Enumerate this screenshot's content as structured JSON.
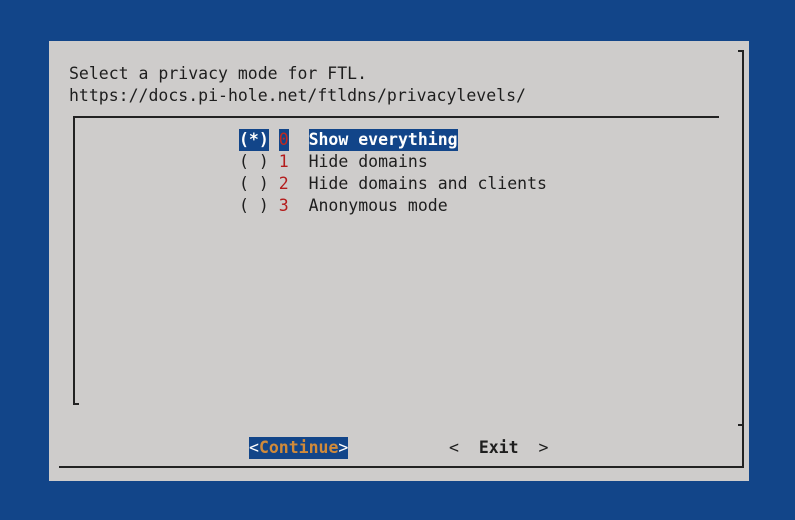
{
  "dialog": {
    "prompt_line1": "Select a privacy mode for FTL.",
    "prompt_line2": "https://docs.pi-hole.net/ftldns/privacylevels/"
  },
  "options": [
    {
      "mark": "(*)",
      "tag": "0",
      "label": "Show everything",
      "selected": true
    },
    {
      "mark": "( )",
      "tag": "1",
      "label": "Hide domains",
      "selected": false
    },
    {
      "mark": "( )",
      "tag": "2",
      "label": "Hide domains and clients",
      "selected": false
    },
    {
      "mark": "( )",
      "tag": "3",
      "label": "Anonymous mode",
      "selected": false
    }
  ],
  "buttons": {
    "continue_open": "<",
    "continue_first": "C",
    "continue_rest": "ontinue",
    "continue_close": ">",
    "exit_open": "<",
    "exit_label": "Exit",
    "exit_close": ">"
  },
  "colors": {
    "background": "#124589",
    "dialog": "#cecccb",
    "highlight": "#124589",
    "tag": "#b41c1c",
    "button_accent": "#d08a3a"
  }
}
